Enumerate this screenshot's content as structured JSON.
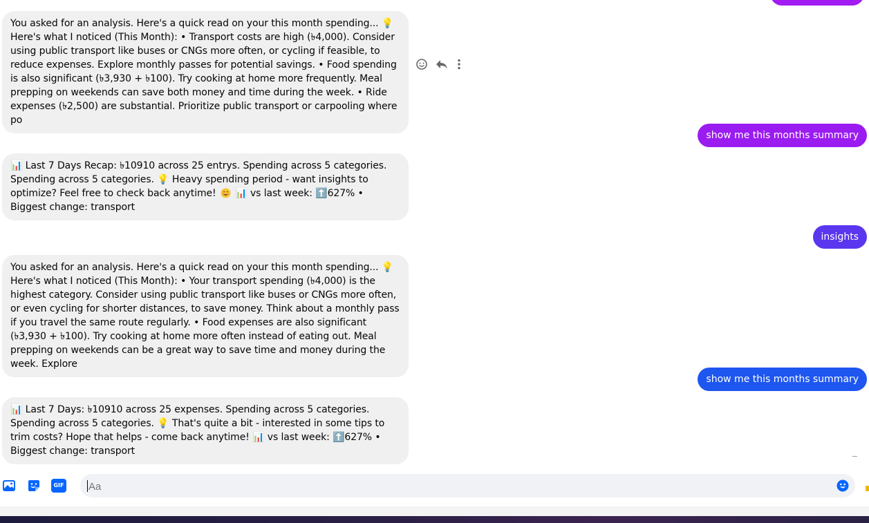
{
  "messages": [
    {
      "direction": "incoming",
      "text": "You asked for an analysis. Here's a quick read on your this month spending... 💡 Here's what I noticed (This Month): • Transport costs are high (৳4,000). Consider using public transport like buses or CNGs more often, or cycling if feasible, to reduce expenses. Explore monthly passes for potential savings. • Food spending is also significant (৳3,930 + ৳100). Try cooking at home more frequently. Meal prepping on weekends can save both money and time during the week. • Ride expenses (৳2,500) are substantial. Prioritize public transport or carpooling where po"
    },
    {
      "direction": "outgoing",
      "text": "show me this months summary",
      "color": "#9b1cf0"
    },
    {
      "direction": "incoming",
      "text_before_smile": "📊 Last 7 Days Recap: ৳10910 across 25 entrys. Spending across 5 categories. Spending across 5 categories. 💡 Heavy spending period - want insights to optimize? Feel free to check back anytime!",
      "text_after_smile": "📊 vs last week: ⬆️627% • Biggest change: transport"
    },
    {
      "direction": "outgoing",
      "text": "insights",
      "color": "#5b36ef"
    },
    {
      "direction": "incoming",
      "text": "You asked for an analysis. Here's a quick read on your this month spending... 💡 Here's what I noticed (This Month): • Your transport spending (৳4,000) is the highest category. Consider using public transport like buses or CNGs more often, or even cycling for shorter distances, to save money. Think about a monthly pass if you travel the same route regularly. • Food expenses are also significant (৳3,930 + ৳100). Try cooking at home more often instead of eating out. Meal prepping on weekends can be a great way to save time and money during the week. Explore"
    },
    {
      "direction": "outgoing",
      "text": "show me this months summary",
      "color": "#1e56f0"
    },
    {
      "direction": "incoming",
      "text": "📊 Last 7 Days: ৳10910 across 25 expenses. Spending across 5 categories. Spending across 5 categories. 💡 That's quite a bit - interested in some tips to trim costs? Hope that helps - come back anytime! 📊 vs last week: ⬆️627% • Biggest change: transport"
    }
  ],
  "message_actions": [
    "smiley-icon",
    "reply-icon",
    "more-icon"
  ],
  "composer": {
    "placeholder": "Aa",
    "value": "",
    "attach_image": "image-icon",
    "sticker": "sticker-icon",
    "gif_label": "GIF",
    "emoji": "emoji-icon"
  },
  "colors": {
    "incoming_bubble": "#f0f0f0",
    "accent": "#0866ff"
  }
}
